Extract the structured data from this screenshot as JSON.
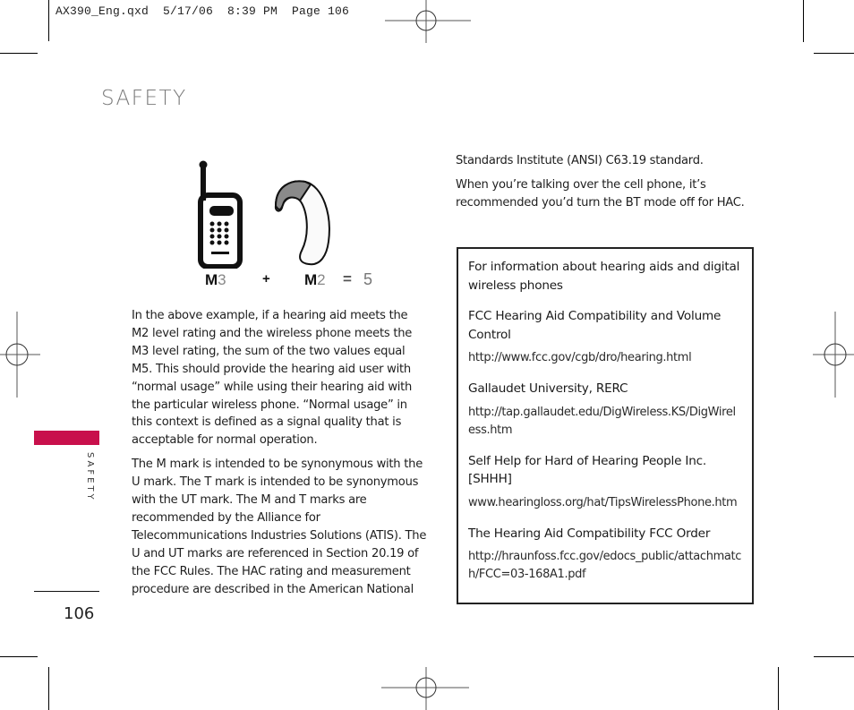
{
  "print_slug": "AX390_Eng.qxd  5/17/06  8:39 PM  Page 106",
  "header": {
    "title": "SAFETY"
  },
  "sidebar": {
    "section_label": "SAFETY",
    "tab_color": "#c8104c"
  },
  "footer": {
    "page_number": "106"
  },
  "illustration": {
    "phone_label_prefix": "M",
    "phone_label_value": "3",
    "plus": "+",
    "aid_label_prefix": "M",
    "aid_label_value": "2",
    "equals": "=",
    "sum": "5",
    "icons": [
      "cell-phone-icon",
      "hearing-aid-icon"
    ]
  },
  "left_column": {
    "paragraphs": [
      "In the above example, if a hearing aid meets the M2 level rating and the wireless phone meets the M3 level rating, the sum of the two values equal M5. This should provide the hearing aid user with “normal usage” while using their hearing aid with the particular wireless phone. “Normal usage” in this context is defined as a signal quality that is acceptable for normal  operation.",
      "The M mark is intended to be synonymous with the U mark. The T mark is intended to be synonymous with the UT mark. The M and T marks are recommended by the Alliance for Telecommunications Industries Solutions (ATIS). The U and UT marks are referenced in Section 20.19 of the FCC Rules. The HAC rating and measurement procedure are described in the American National"
    ]
  },
  "right_column": {
    "paragraphs": [
      "Standards Institute (ANSI) C63.19 standard.",
      "When you’re talking over the cell phone, it’s recommended you’d turn the BT mode off for HAC."
    ]
  },
  "info_box": {
    "intro": "For information about hearing aids and digital wireless phones",
    "resources": [
      {
        "name": "FCC Hearing Aid Compatibility and Volume Control",
        "url": "http://www.fcc.gov/cgb/dro/hearing.html"
      },
      {
        "name": "Gallaudet University, RERC",
        "url": "http://tap.gallaudet.edu/DigWireless.KS/DigWireless.htm"
      },
      {
        "name": "Self Help for Hard of Hearing People Inc. [SHHH]",
        "url": "www.hearingloss.org/hat/TipsWirelessPhone.htm"
      },
      {
        "name": "The Hearing Aid Compatibility FCC Order",
        "url": "http://hraunfoss.fcc.gov/edocs_public/attachmatch/FCC=03-168A1.pdf"
      }
    ]
  }
}
